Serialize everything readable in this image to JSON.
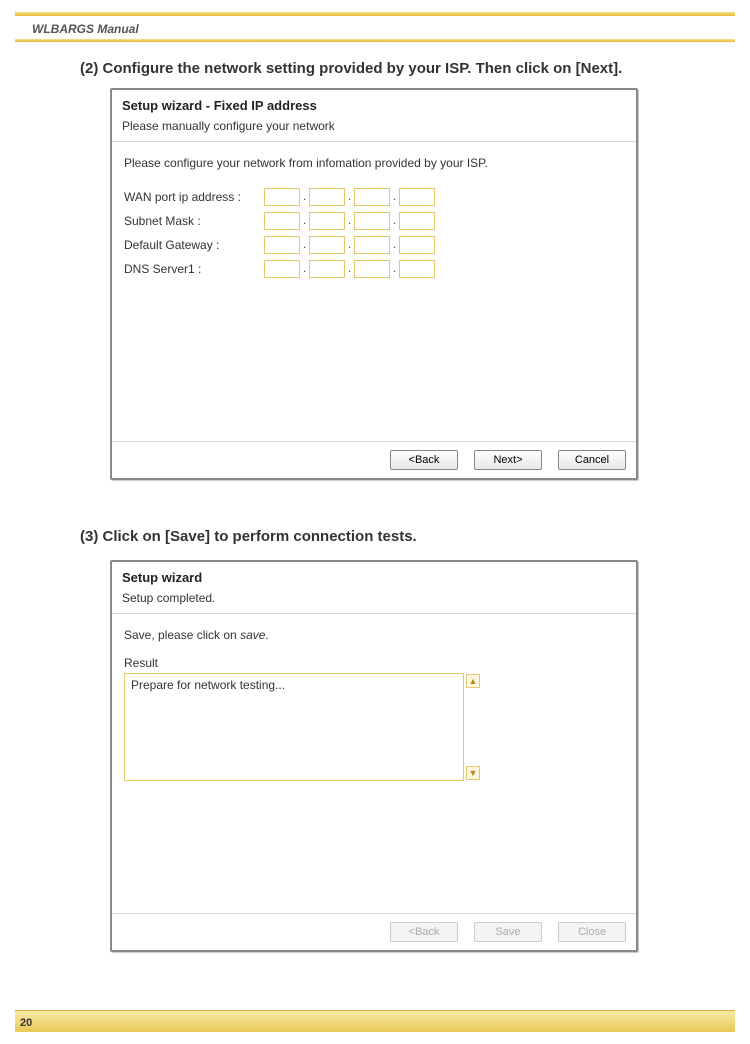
{
  "doc": {
    "title": "WLBARGS Manual",
    "pageNumber": "20"
  },
  "section2": {
    "instruction": "(2) Configure the network setting provided by your ISP. Then click on [Next].",
    "dialog": {
      "title": "Setup wizard - Fixed IP address",
      "subtitle": "Please manually configure your network",
      "hint": "Please configure your network from infomation provided by your ISP.",
      "fields": {
        "wan": "WAN port ip address :",
        "subnet": "Subnet Mask :",
        "gateway": "Default Gateway :",
        "dns1": "DNS Server1 :"
      },
      "buttons": {
        "back": "<Back",
        "next": "Next>",
        "cancel": "Cancel"
      }
    }
  },
  "section3": {
    "instruction": "(3) Click on [Save] to perform connection tests.",
    "dialog": {
      "title": "Setup wizard",
      "subtitle": "Setup completed.",
      "saveHintPre": "Save, please click on ",
      "saveHintEm": "save",
      "saveHintPost": ".",
      "resultLabel": "Result",
      "resultText": "Prepare for network testing...",
      "buttons": {
        "back": "<Back",
        "save": "Save",
        "close": "Close"
      }
    }
  }
}
